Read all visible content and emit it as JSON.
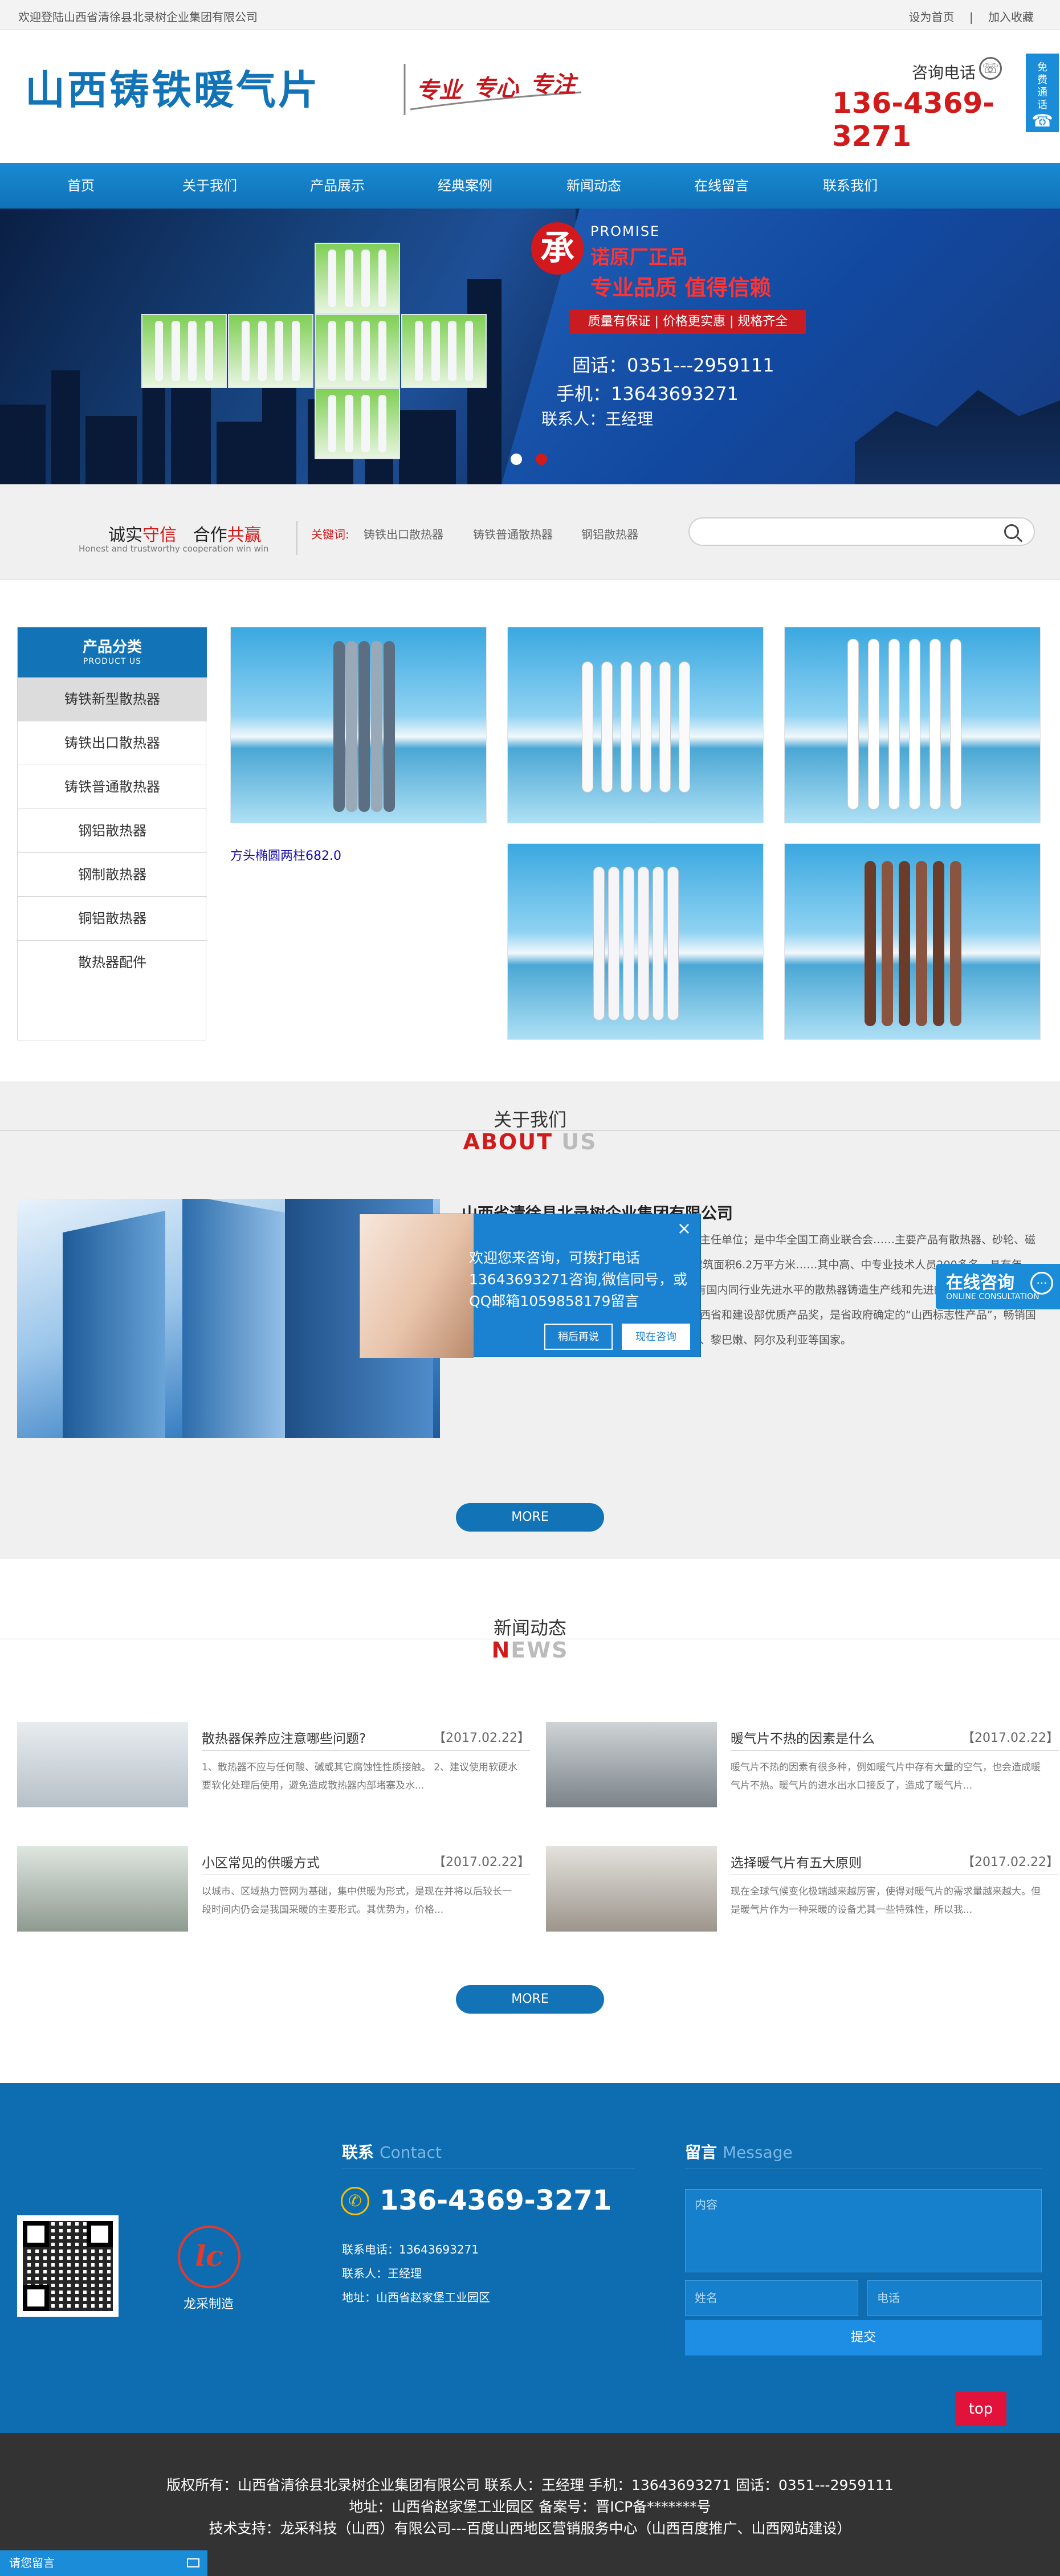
{
  "topbar": {
    "welcome": "欢迎登陆山西省清徐县北录树企业集团有限公司",
    "set_home": "设为首页",
    "separator": "|",
    "add_fav": "加入收藏"
  },
  "header": {
    "logo": "山西铸铁暖气片",
    "slogan": [
      "专业",
      "专心",
      "专注"
    ],
    "phone_label": "咨询电话",
    "phone_number": "136-4369-3271",
    "free_call": "免费通话"
  },
  "nav": {
    "items": [
      "首页",
      "关于我们",
      "产品展示",
      "经典案例",
      "新闻动态",
      "在线留言",
      "联系我们"
    ]
  },
  "banner": {
    "badge": "承",
    "en": "PROMISE",
    "line1": "诺原厂正品",
    "line2": "专业品质   值得信赖",
    "tags": "质量有保证 | 价格更实惠 | 规格齐全",
    "tel": "固话：0351---2959111",
    "mobile": "手机：13643693271",
    "contact": "联系人：王经理"
  },
  "search": {
    "credo_a": "诚实",
    "credo_a2": "守信",
    "credo_b": "合作",
    "credo_b2": "共赢",
    "credo_en": "Honest and trustworthy cooperation win win",
    "kw_label": "关键词:",
    "keywords": [
      "铸铁出口散热器",
      "铸铁普通散热器",
      "钢铝散热器"
    ]
  },
  "products": {
    "side_title": "产品分类",
    "side_title_en": "PRODUCT US",
    "categories": [
      "铸铁新型散热器",
      "铸铁出口散热器",
      "铸铁普通散热器",
      "钢铝散热器",
      "钢制散热器",
      "铜铝散热器",
      "散热器配件"
    ],
    "broken_image_alt": "方头椭圆两柱682.0"
  },
  "about": {
    "title": "关于我们",
    "en_a": "ABOUT",
    "en_b": " US",
    "company": "山西省清徐县北录树企业集团有限公司",
    "text": "是国家定点生产基地，是中国采暖散热器委员会副主任单位；是中华全国工商业联合会……主要产品有散热器、砂轮、磁性材料、铸产品、……总面积20万平方米，其中建筑面积6.2万平方米……其中高、中专业技术人员200多名。具有年产……万片/年的生产能力，年耗生铁12万吨，拥有国内同行业先进水平的散热器铸造生产线和先进的机械加工设备，配备有完善的分析检测设备。历年来荣获太原市、山西省和建设部优质产品奖，是省政府确定的“山西标志性产品”，畅销国内所有采暖地区，并出口到美国、俄罗斯、叙利亚、黎巴嫩、阿尔及利亚等国家。",
    "more": "MORE"
  },
  "popup": {
    "message": "欢迎您来咨询，可拨打电话13643693271咨询,微信同号，或QQ邮箱1059858179留言",
    "later": "稍后再说",
    "now": "现在咨询",
    "close": "×"
  },
  "online": {
    "label": "在线咨询",
    "label_en": "ONLINE CONSULTATION"
  },
  "news": {
    "title": "新闻动态",
    "en_a": "N",
    "en_b": "EWS",
    "items": [
      {
        "title": "散热器保养应注意哪些问题?",
        "date": "【2017.02.22】",
        "summary": "1、散热器不应与任何酸、碱或其它腐蚀性性质接触。 2、建议使用软硬水要软化处理后使用，避免造成散热器内部堵塞及水..."
      },
      {
        "title": "暖气片不热的因素是什么",
        "date": "【2017.02.22】",
        "summary": "暖气片不热的因素有很多种，例如暖气片中存有大量的空气，也会造成暖气片不热。暖气片的进水出水口接反了，造成了暖气片..."
      },
      {
        "title": "小区常见的供暖方式",
        "date": "【2017.02.22】",
        "summary": "以城市、区域热力管网为基础，集中供暖为形式，是现在并将以后较长一段时间内仍会是我国采暖的主要形式。其优势为，价格..."
      },
      {
        "title": "选择暖气片有五大原则",
        "date": "【2017.02.22】",
        "summary": "现在全球气候变化极端越来越厉害，使得对暖气片的需求量越来越大。但是暖气片作为一种采暖的设备尤其一些特殊性，所以我..."
      }
    ],
    "more": "MORE"
  },
  "footer": {
    "contact_h": "联系",
    "contact_en": "Contact",
    "phone": "136-4369-3271",
    "tel_line": "联系电话：13643693271",
    "person_line": "联系人：王经理",
    "addr_line": "地址：山西省赵家堡工业园区",
    "brand": "龙采制造",
    "brand_mark": "lc",
    "msg_h": "留言",
    "msg_en": "Message",
    "content_ph": "内容",
    "name_ph": "姓名",
    "tel_ph": "电话",
    "submit": "提交",
    "top": "top"
  },
  "copyright": {
    "line1": "版权所有：山西省清徐县北录树企业集团有限公司 联系人：王经理   手机：13643693271    固话：0351---2959111",
    "line2": "地址：山西省赵家堡工业园区 备案号：晋ICP备*******号",
    "line3": "技术支持：龙采科技（山西）有限公司---百度山西地区营销服务中心（山西百度推广、山西网站建设）"
  },
  "leave_msg": "请您留言",
  "colors": {
    "brand_blue": "#1274b6",
    "accent_red": "#d31a1a",
    "footer_blue": "#0e6db0"
  }
}
